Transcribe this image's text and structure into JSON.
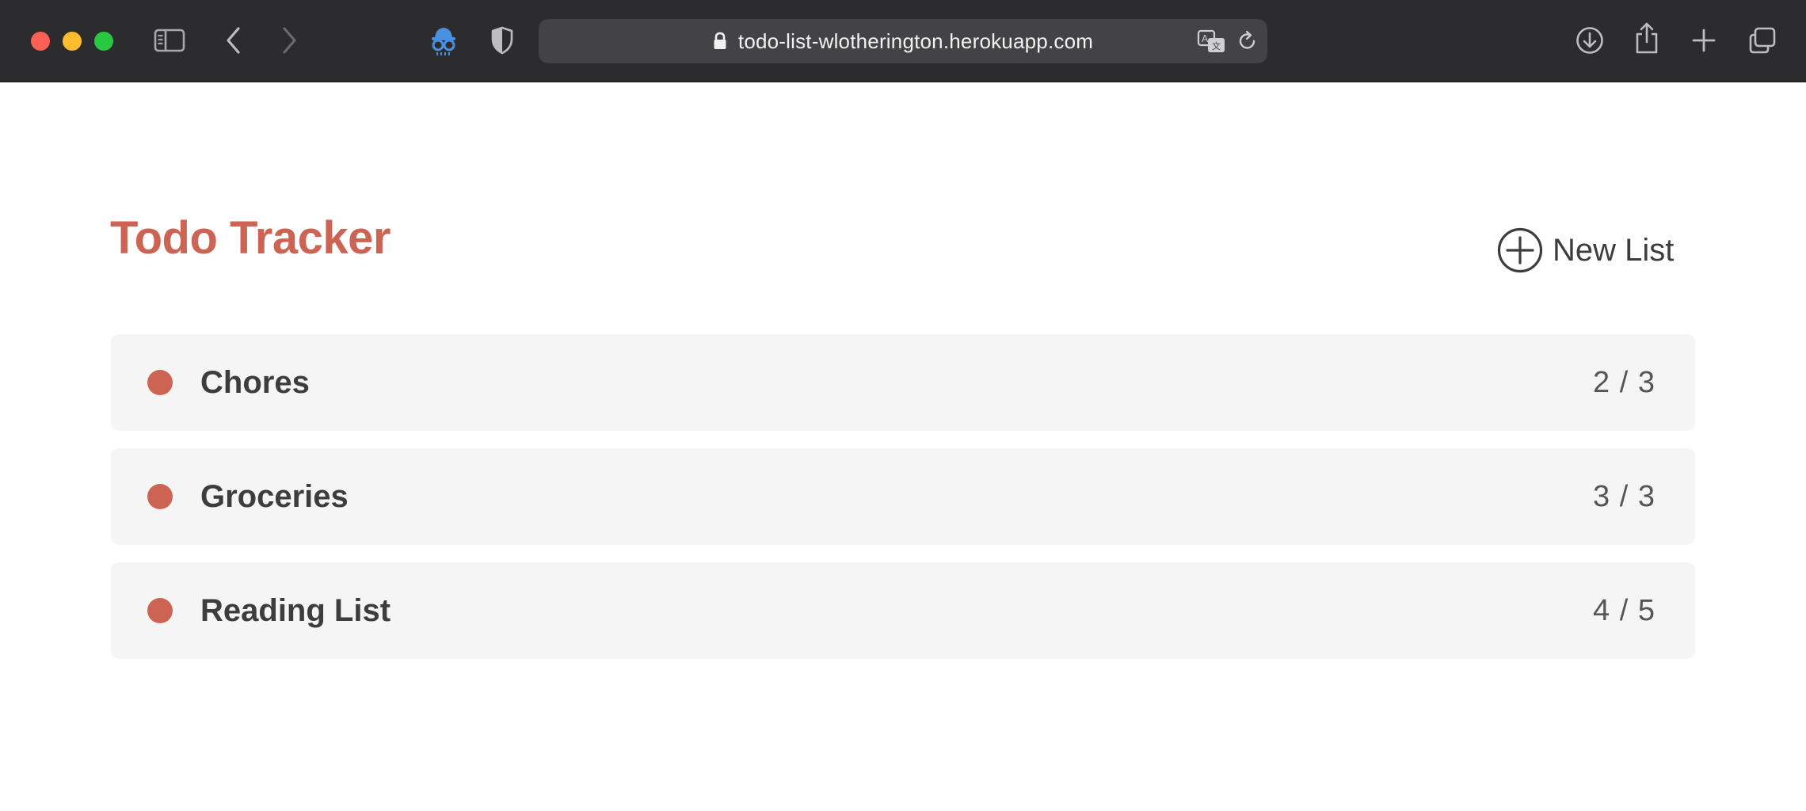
{
  "browser": {
    "url": "todo-list-wlotherington.herokuapp.com",
    "icons": [
      "sidebar-icon",
      "back-icon",
      "forward-icon",
      "extension-icon",
      "privacy-shield-icon",
      "lock-icon",
      "translate-icon",
      "reload-icon",
      "downloads-icon",
      "share-icon",
      "new-tab-icon",
      "tab-overview-icon"
    ]
  },
  "page": {
    "title": "Todo Tracker",
    "new_list_label": "New List"
  },
  "lists": [
    {
      "name": "Chores",
      "count": "2 / 3"
    },
    {
      "name": "Groceries",
      "count": "3 / 3"
    },
    {
      "name": "Reading List",
      "count": "4 / 5"
    }
  ],
  "colors": {
    "accent": "#cd6453",
    "card_background": "#f5f5f5",
    "toolbar_background": "#2c2c2e"
  }
}
